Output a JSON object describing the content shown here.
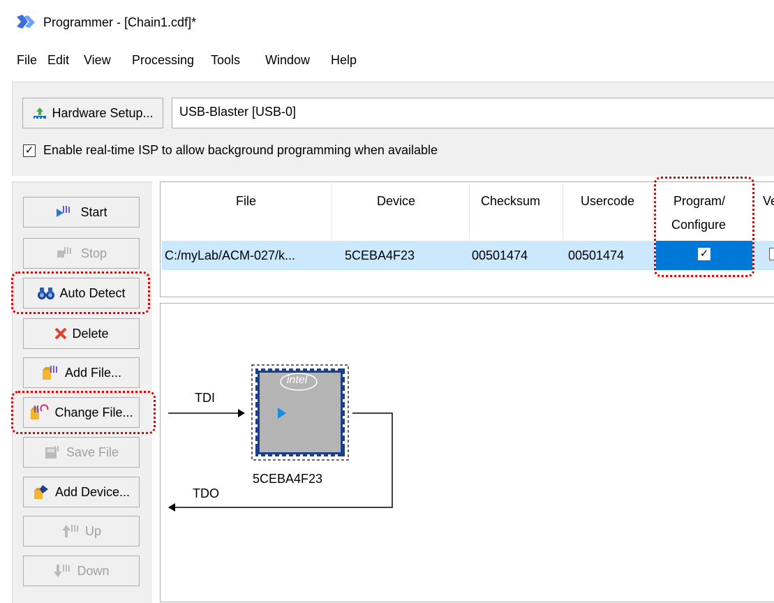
{
  "window": {
    "title": "Programmer - [Chain1.cdf]*"
  },
  "menu": [
    "File",
    "Edit",
    "View",
    "Processing",
    "Tools",
    "Window",
    "Help"
  ],
  "hardware": {
    "setup_label": "Hardware Setup...",
    "selected": "USB-Blaster [USB-0]",
    "isp_label": "Enable real-time ISP to allow background programming when available",
    "isp_checked": true
  },
  "buttons": {
    "start": "Start",
    "stop": "Stop",
    "auto_detect": "Auto Detect",
    "delete": "Delete",
    "add_file": "Add File...",
    "change_file": "Change File...",
    "save_file": "Save File",
    "add_device": "Add Device...",
    "up": "Up",
    "down": "Down"
  },
  "table": {
    "columns": [
      "File",
      "Device",
      "Checksum",
      "Usercode",
      "Program/",
      "Configure",
      "Ve"
    ],
    "rows": [
      {
        "file": "C:/myLab/ACM-027/k...",
        "device": "5CEBA4F23",
        "checksum": "00501474",
        "usercode": "00501474",
        "program_configure": true
      }
    ]
  },
  "diagram": {
    "chip_name": "5CEBA4F23",
    "brand": "intel",
    "tdi": "TDI",
    "tdo": "TDO"
  },
  "colors": {
    "highlight": "#e00000",
    "selection_row": "#cce8ff",
    "selection_cell": "#0078d7",
    "chip_border": "#1b3f8a"
  }
}
